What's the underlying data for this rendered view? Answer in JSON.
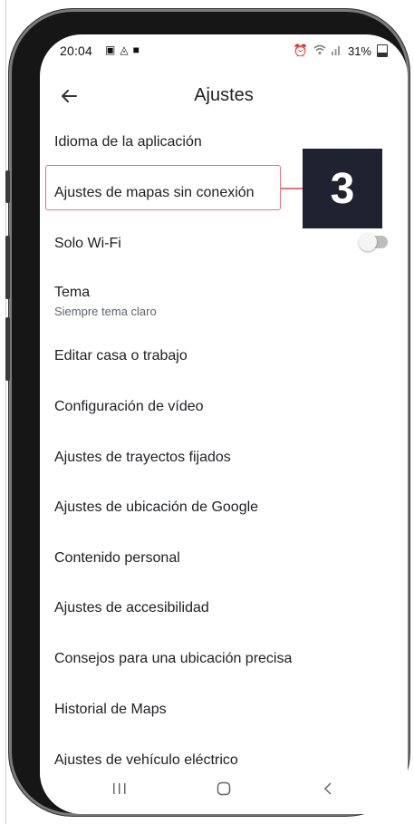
{
  "status_bar": {
    "time": "20:04",
    "left_icons": [
      "image-icon",
      "android-icon",
      "message-icon"
    ],
    "right_icons": [
      "alarm-icon",
      "wifi-icon",
      "signal-icon"
    ],
    "battery": "31%"
  },
  "app_bar": {
    "title": "Ajustes",
    "back_icon": "arrow-left-icon"
  },
  "settings_list": [
    {
      "label": "Idioma de la aplicación"
    },
    {
      "label": "Ajustes de mapas sin conexión"
    },
    {
      "label": "Solo Wi-Fi",
      "toggle": false
    },
    {
      "label": "Tema",
      "sublabel": "Siempre tema claro"
    },
    {
      "label": "Editar casa o trabajo"
    },
    {
      "label": "Configuración de vídeo"
    },
    {
      "label": "Ajustes de trayectos fijados"
    },
    {
      "label": "Ajustes de ubicación de Google"
    },
    {
      "label": "Contenido personal"
    },
    {
      "label": "Ajustes de accesibilidad"
    },
    {
      "label": "Consejos para una ubicación precisa"
    },
    {
      "label": "Historial de Maps"
    },
    {
      "label": "Ajustes de vehículo eléctrico"
    }
  ],
  "callout": {
    "number": "3",
    "highlight_color": "#e5737d",
    "box_color": "#1f2230"
  },
  "nav_bar": {
    "recent": "|||",
    "home": "◯",
    "back": "‹"
  }
}
